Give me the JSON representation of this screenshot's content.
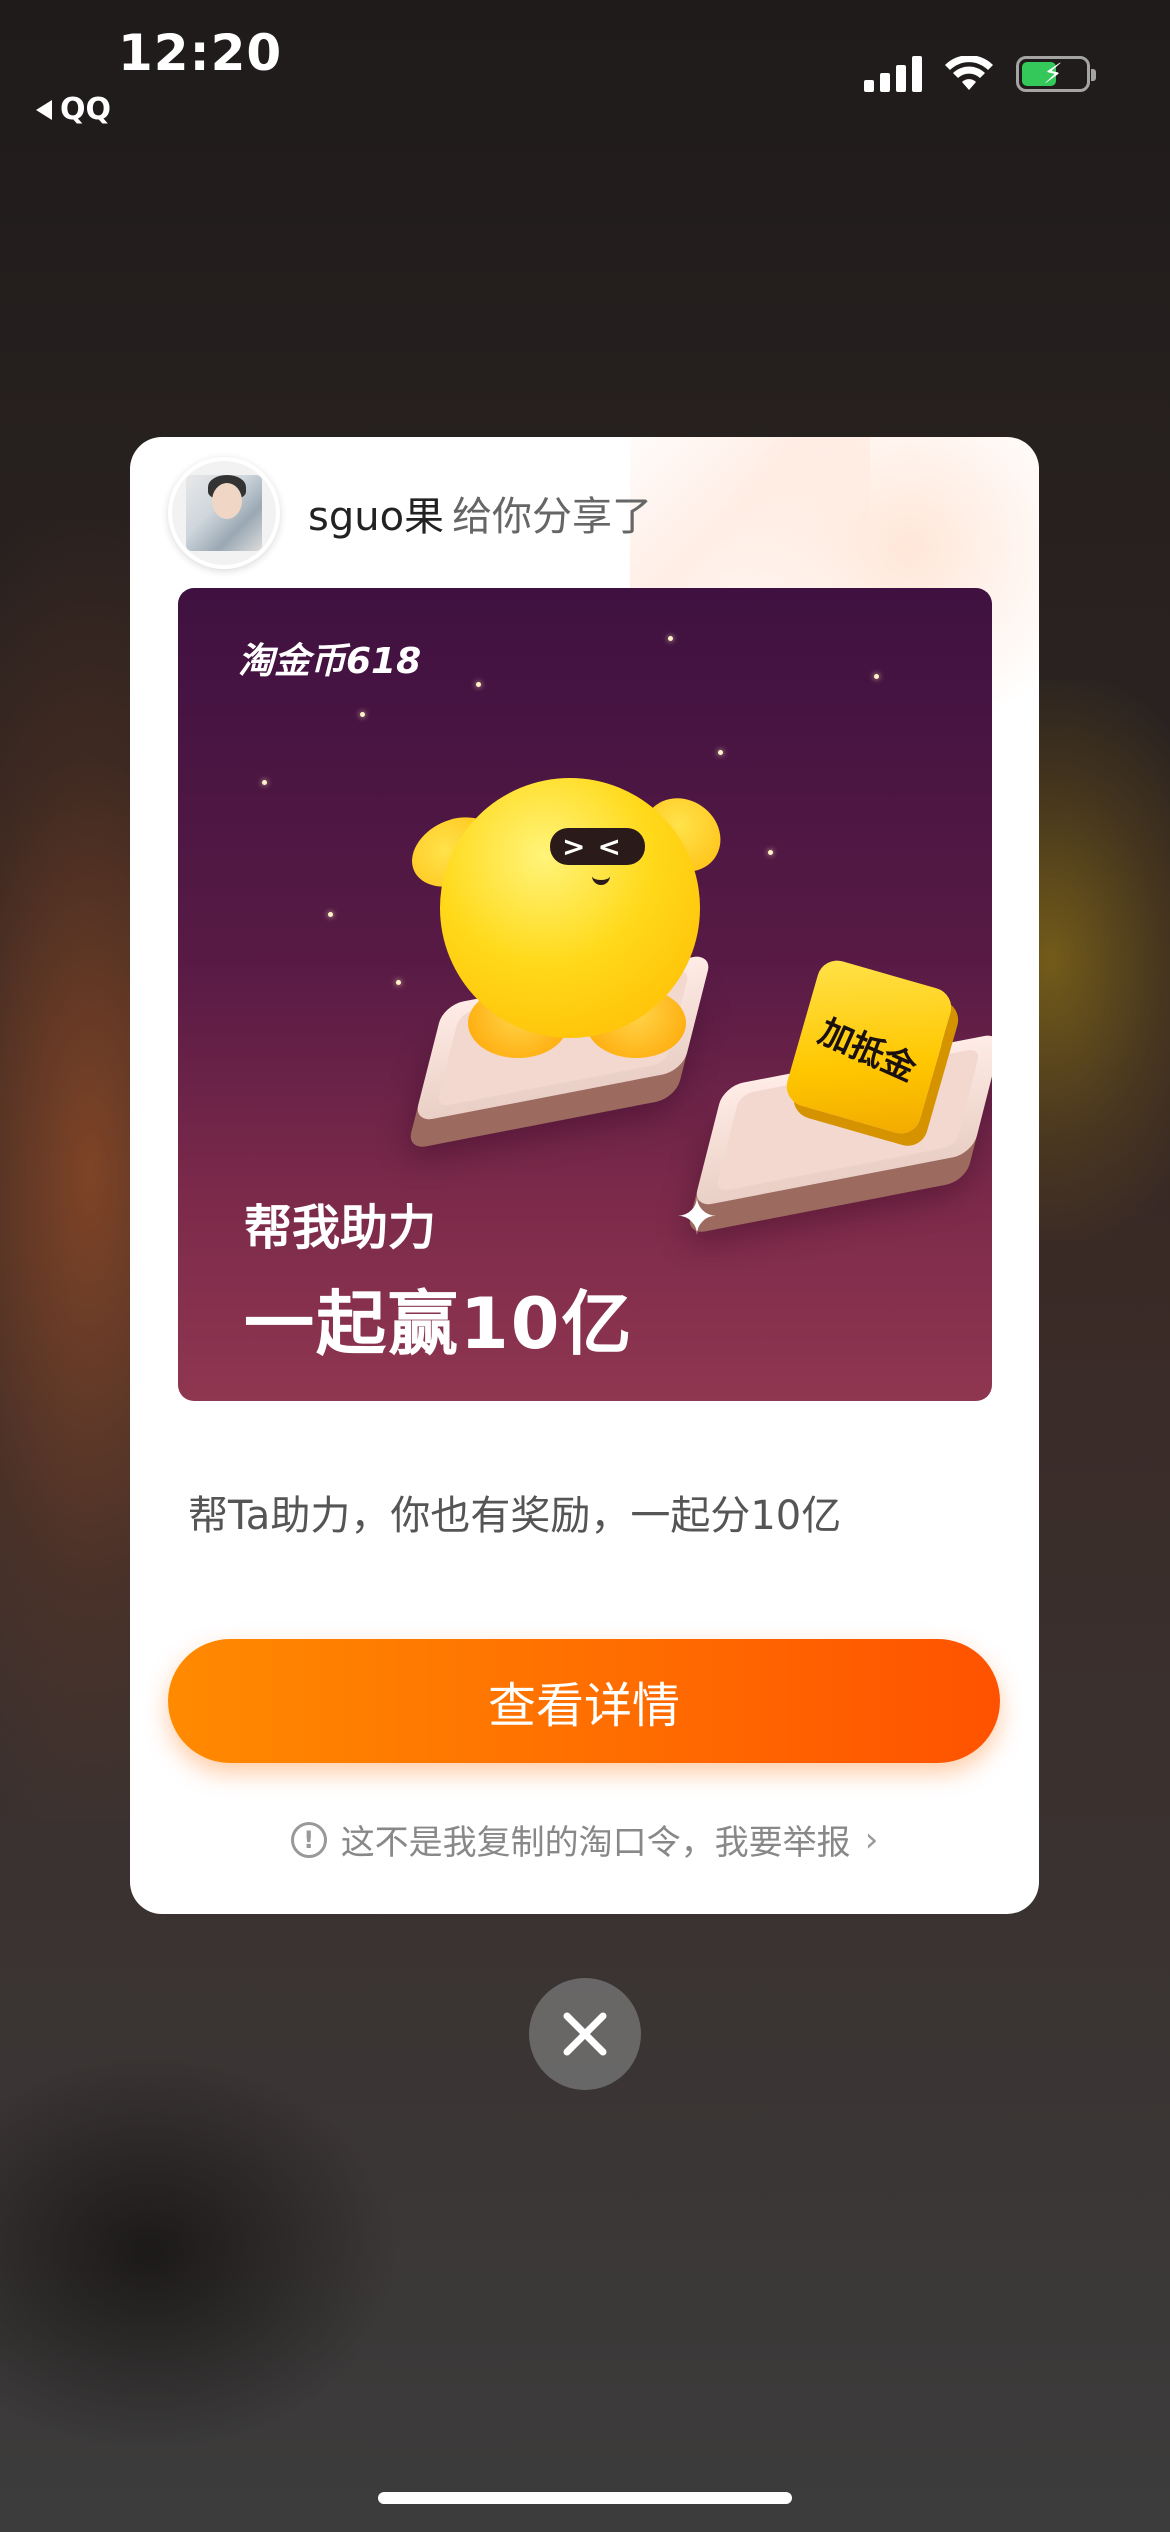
{
  "status_bar": {
    "time": "12:20",
    "back_app": "QQ",
    "battery_level": 0.55,
    "battery_color": "#34c759"
  },
  "share_card": {
    "user_name": "sguo果",
    "action_text": "给你分享了",
    "poster": {
      "brand": "淘金币618",
      "coupon_label": "加抵金",
      "headline_line1": "帮我助力",
      "headline_line2": "一起赢10亿"
    },
    "description": "帮Ta助力，你也有奖励，一起分10亿",
    "cta_label": "查看详情",
    "report_text": "这不是我复制的淘口令，我要举报",
    "accent_color": "#ff6a00"
  },
  "icons": {
    "close": "close-icon",
    "report": "exclamation-circle-icon",
    "chevron": "chevron-right-icon"
  }
}
